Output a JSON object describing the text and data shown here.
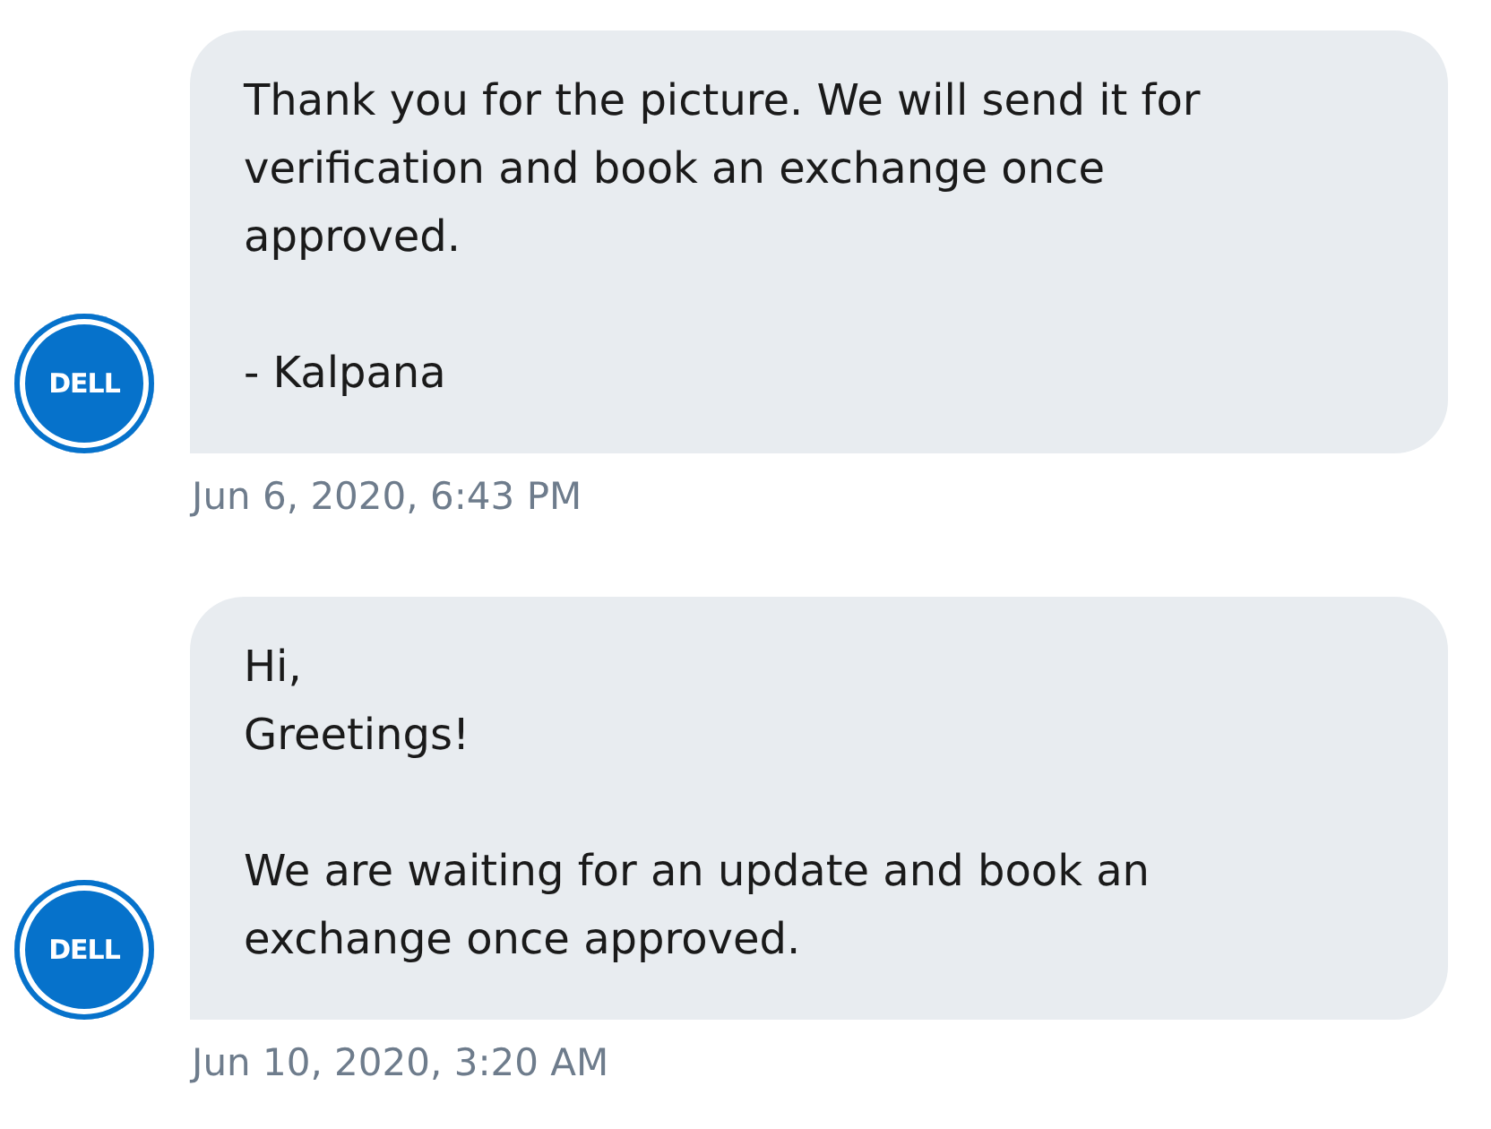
{
  "messages": [
    {
      "avatar": "DELL",
      "text": "Thank you for the picture. We will send it for\nverification and book an exchange once\napproved.\n\n- Kalpana",
      "time": "Jun 6, 2020, 6:43 PM"
    },
    {
      "avatar": "DELL",
      "text": "Hi,\nGreetings!\n\nWe are waiting for an update and book an\nexchange once approved.",
      "time": "Jun 10, 2020, 3:20 AM"
    }
  ]
}
